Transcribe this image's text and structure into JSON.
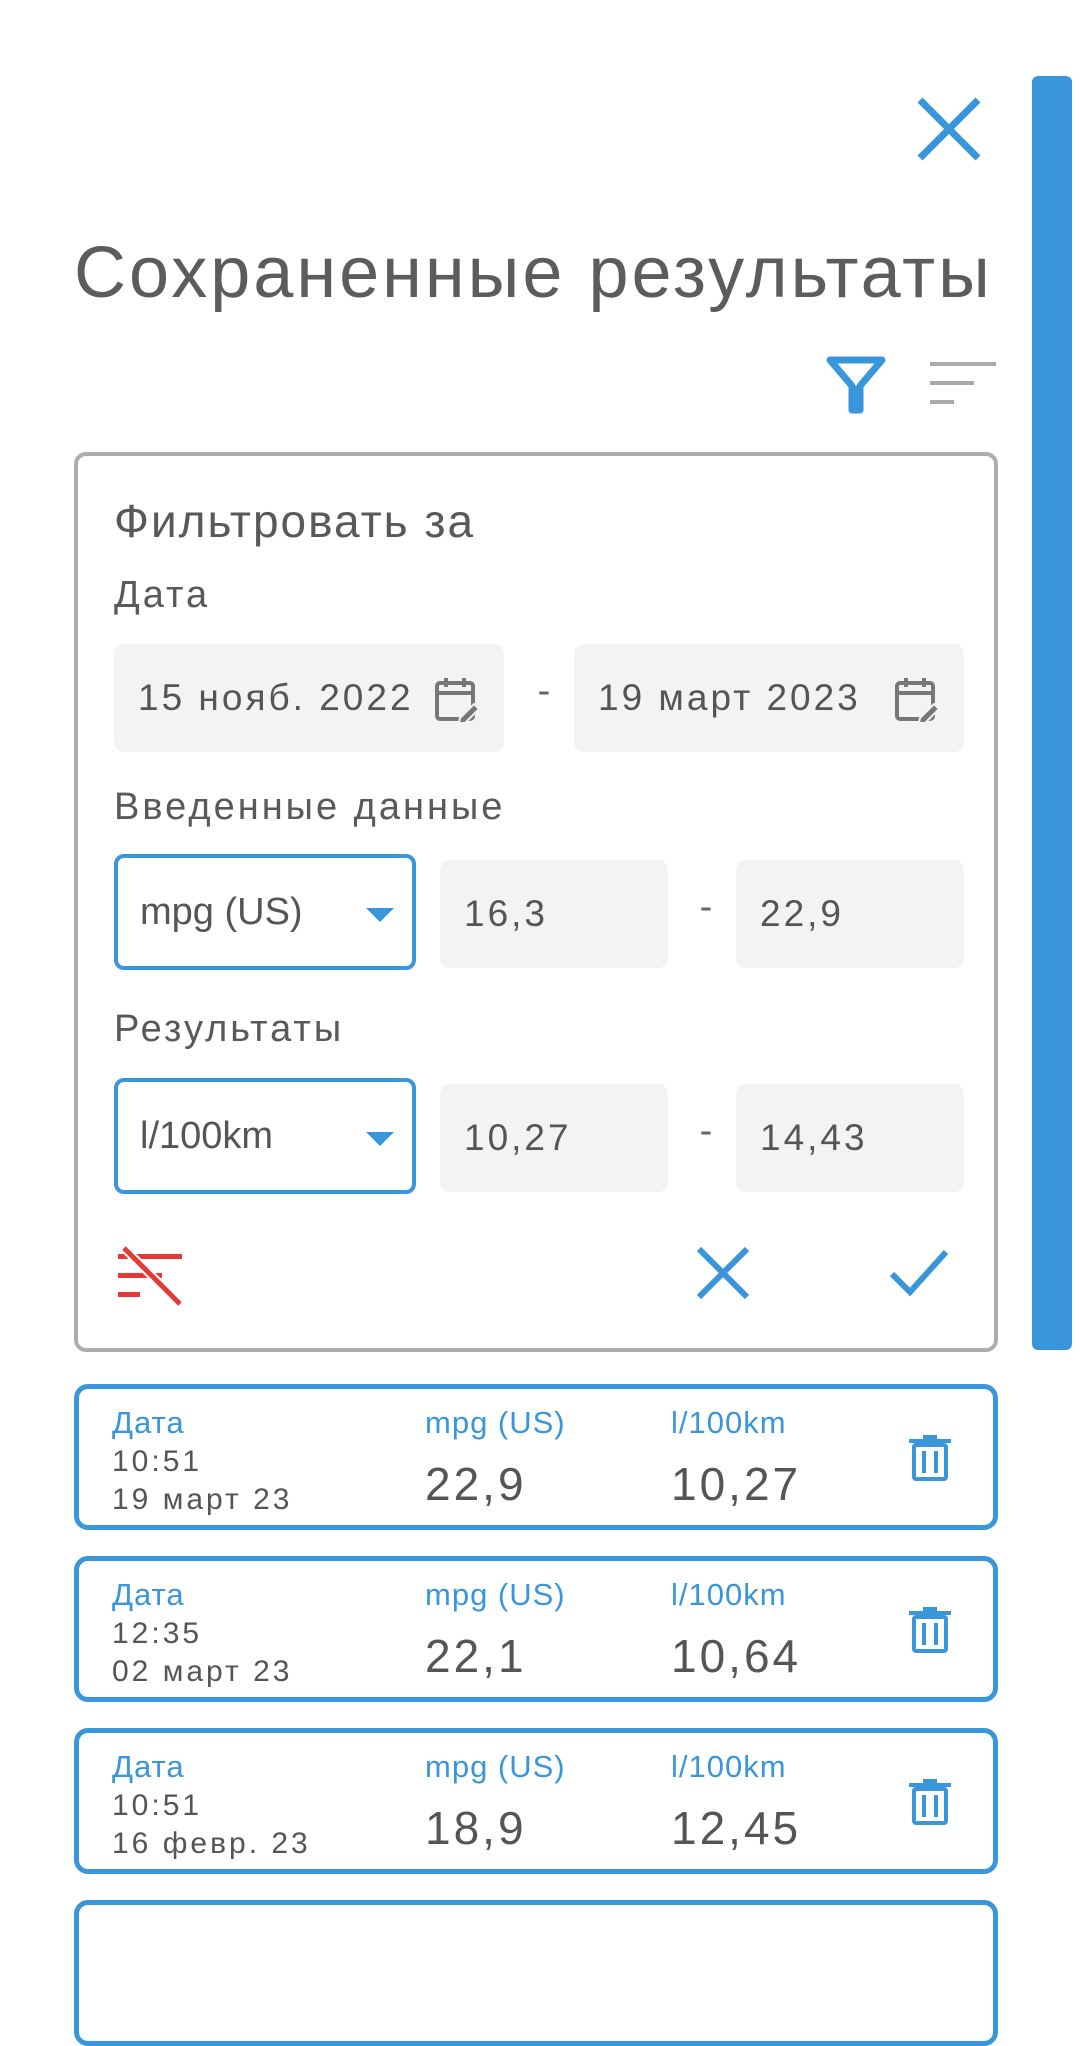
{
  "header": {
    "title": "Сохраненные результаты"
  },
  "icons": {
    "close": "close-icon",
    "filter": "filter-icon",
    "sort": "sort-icon",
    "calendar": "calendar-edit-icon",
    "clear_filter": "clear-filter-icon",
    "cancel": "close-icon",
    "apply": "check-icon",
    "delete": "trash-icon"
  },
  "colors": {
    "accent": "#3a96db",
    "danger": "#e53935",
    "field_bg": "#f2f3f5",
    "panel_border": "#adadad"
  },
  "filter": {
    "title": "Фильтровать за",
    "date_label": "Дата",
    "date_from": "15 нояб. 2022",
    "date_to": "19 март 2023",
    "dash": "-",
    "input_label": "Введенные данные",
    "input_unit": "mpg (US)",
    "input_min": "16,3",
    "input_max": "22,9",
    "result_label": "Результаты",
    "result_unit": "l/100km",
    "result_min": "10,27",
    "result_max": "14,43"
  },
  "results": [
    {
      "date_label": "Дата",
      "time": "10:51",
      "date": "19 март 23",
      "input_unit": "mpg (US)",
      "input_value": "22,9",
      "result_unit": "l/100km",
      "result_value": "10,27"
    },
    {
      "date_label": "Дата",
      "time": "12:35",
      "date": "02 март 23",
      "input_unit": "mpg (US)",
      "input_value": "22,1",
      "result_unit": "l/100km",
      "result_value": "10,64"
    },
    {
      "date_label": "Дата",
      "time": "10:51",
      "date": "16 февр. 23",
      "input_unit": "mpg (US)",
      "input_value": "18,9",
      "result_unit": "l/100km",
      "result_value": "12,45"
    }
  ]
}
